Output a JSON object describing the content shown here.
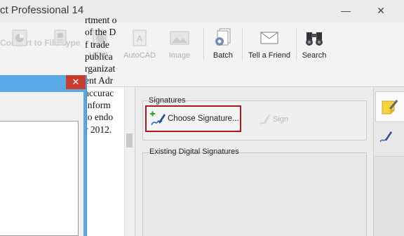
{
  "window": {
    "title": "ct Professional 14",
    "minimize": "—",
    "close": "✕"
  },
  "ribbon": {
    "group_label": "Convert to File Type",
    "items": [
      {
        "label": "",
        "icon": "pie-chart-icon",
        "enabled": false
      },
      {
        "label": "",
        "icon": "document-icon",
        "enabled": false
      },
      {
        "label": "HTML",
        "icon": "html-icon",
        "enabled": false
      },
      {
        "label": "AutoCAD",
        "icon": "autocad-icon",
        "enabled": false
      },
      {
        "label": "Image",
        "icon": "image-icon",
        "enabled": false
      },
      {
        "label": "Batch",
        "icon": "batch-gear-icon",
        "enabled": true
      },
      {
        "label": "Tell a Friend",
        "icon": "envelope-icon",
        "enabled": true
      },
      {
        "label": "Search",
        "icon": "binoculars-icon",
        "enabled": true
      }
    ]
  },
  "document": {
    "lines": [
      "rtment o",
      "of the D",
      "f trade ",
      " publica",
      "rganizat",
      "ent Adr",
      "accurac",
      " inform",
      "to endo",
      "r 2012."
    ]
  },
  "dialog": {
    "close": "✕"
  },
  "signatures": {
    "group_label": "Signatures",
    "choose_label": "Choose Signature...",
    "sign_label": "Sign",
    "existing_label": "Existing Digital Signatures"
  },
  "sidebar": {
    "items": [
      "sticky-note-icon",
      "signature-pen-icon"
    ]
  },
  "colors": {
    "highlight": "#a61b1b",
    "dialog_title": "#5aa9e6",
    "dialog_close": "#c83c2e",
    "accent_blue": "#1f5fbf"
  }
}
